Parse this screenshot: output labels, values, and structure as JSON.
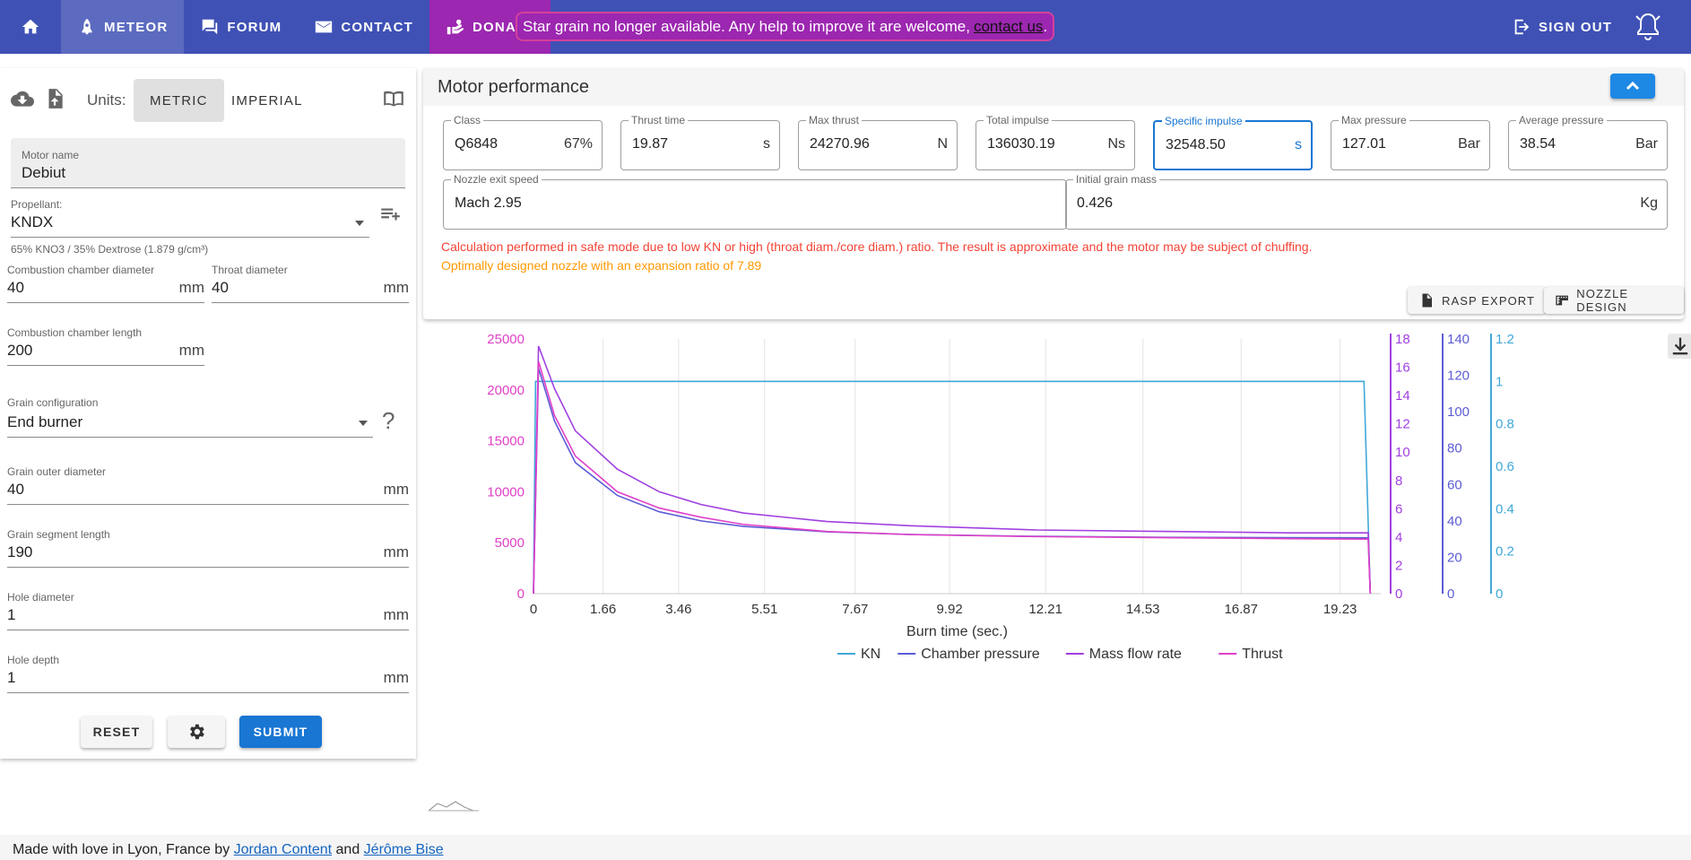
{
  "nav": {
    "home_icon": "home-icon",
    "items": [
      {
        "label": "METEOR",
        "icon": "rocket-icon"
      },
      {
        "label": "FORUM",
        "icon": "forum-icon"
      },
      {
        "label": "CONTACT",
        "icon": "mail-icon"
      },
      {
        "label": "DONATE",
        "icon": "donate-icon"
      }
    ],
    "alert_text": "Star grain no longer available. Any help to improve it are welcome,",
    "alert_link": "contact us",
    "alert_end": ".",
    "signout": "SIGN OUT",
    "colors": {
      "bar": "#3f51b5",
      "donate": "#9c27b0"
    }
  },
  "form": {
    "units_label": "Units:",
    "unit_metric": "METRIC",
    "unit_imperial": "IMPERIAL",
    "motor_name_label": "Motor name",
    "motor_name": "Debiut",
    "propellant_label": "Propellant:",
    "propellant": "KNDX",
    "propellant_hint": "65% KNO3 / 35% Dextrose (1.879 g/cm³)",
    "chamber_diameter_label": "Combustion chamber diameter",
    "chamber_diameter": "40",
    "throat_diameter_label": "Throat diameter",
    "throat_diameter": "40",
    "chamber_length_label": "Combustion chamber length",
    "chamber_length": "200",
    "grain_config_label": "Grain configuration",
    "grain_config": "End burner",
    "grain_outer_label": "Grain outer diameter",
    "grain_outer": "40",
    "segment_length_label": "Grain segment length",
    "segment_length": "190",
    "hole_diameter_label": "Hole diameter",
    "hole_diameter": "1",
    "hole_depth_label": "Hole depth",
    "hole_depth": "1",
    "unit_mm": "mm",
    "help": "?",
    "reset": "RESET",
    "submit": "SUBMIT"
  },
  "performance": {
    "title": "Motor performance",
    "class_label": "Class",
    "class": "Q6848",
    "class_pct": "67%",
    "thrust_time_label": "Thrust time",
    "thrust_time": "19.87",
    "thrust_time_unit": "s",
    "max_thrust_label": "Max thrust",
    "max_thrust": "24270.96",
    "max_thrust_unit": "N",
    "total_impulse_label": "Total impulse",
    "total_impulse": "136030.19",
    "total_impulse_unit": "Ns",
    "isp_label": "Specific impulse",
    "isp": "32548.50",
    "isp_unit": "s",
    "max_pressure_label": "Max pressure",
    "max_pressure": "127.01",
    "max_pressure_unit": "Bar",
    "avg_pressure_label": "Average pressure",
    "avg_pressure": "38.54",
    "avg_pressure_unit": "Bar",
    "nozzle_speed_label": "Nozzle exit speed",
    "nozzle_speed": "Mach 2.95",
    "grain_mass_label": "Initial grain mass",
    "grain_mass": "0.426",
    "grain_mass_unit": "Kg",
    "warning_red": "Calculation performed in safe mode due to low KN or high (throat diam./core diam.) ratio. The result is approximate and the motor may be subject of chuffing.",
    "warning_orange": "Optimally designed nozzle with an expansion ratio of 7.89",
    "rasp_export": "RASP EXPORT",
    "nozzle_design": "NOZZLE DESIGN"
  },
  "chart_data": {
    "type": "line",
    "xlabel": "Burn time (sec.)",
    "x_ticks": [
      "0",
      "1.66",
      "3.46",
      "5.51",
      "7.67",
      "9.92",
      "12.21",
      "14.53",
      "16.87",
      "19.23"
    ],
    "xlim": [
      0,
      20.2
    ],
    "axes": {
      "thrust": {
        "ticks": [
          "0",
          "5000",
          "10000",
          "15000",
          "20000",
          "25000"
        ],
        "max": 25000,
        "color": "#e040c8"
      },
      "mass_flow": {
        "ticks": [
          "0",
          "2",
          "4",
          "6",
          "8",
          "10",
          "12",
          "14",
          "16",
          "18"
        ],
        "max": 18,
        "color": "#a040e0"
      },
      "pressure": {
        "ticks": [
          "0",
          "20",
          "40",
          "60",
          "80",
          "100",
          "120",
          "140"
        ],
        "max": 140,
        "color": "#5c5cd6"
      },
      "kn": {
        "ticks": [
          "0",
          "0.2",
          "0.4",
          "0.6",
          "0.8",
          "1",
          "1.2"
        ],
        "max": 1.2,
        "color": "#40a8d8"
      }
    },
    "series": [
      {
        "name": "KN",
        "axis": "kn",
        "color": "#40a8d8",
        "x": [
          0,
          0.05,
          19.8,
          19.95
        ],
        "y": [
          0,
          1.0,
          1.0,
          0
        ]
      },
      {
        "name": "Chamber pressure",
        "axis": "pressure",
        "color": "#5c5cd6",
        "x": [
          0,
          0.12,
          0.5,
          1,
          2,
          3,
          4,
          5,
          7,
          9,
          12,
          15,
          18,
          19.9,
          19.95
        ],
        "y": [
          0,
          124,
          95,
          72,
          54,
          45,
          40,
          37,
          34,
          32.5,
          31.5,
          31,
          30.8,
          30.7,
          0
        ]
      },
      {
        "name": "Mass flow rate",
        "axis": "mass_flow",
        "color": "#a040e0",
        "x": [
          0,
          0.12,
          0.5,
          1,
          2,
          3,
          4,
          5,
          7,
          9,
          12,
          15,
          18,
          19.9,
          19.95
        ],
        "y": [
          0,
          17.5,
          14.5,
          11.5,
          8.8,
          7.2,
          6.3,
          5.7,
          5.1,
          4.8,
          4.5,
          4.4,
          4.3,
          4.3,
          0
        ]
      },
      {
        "name": "Thrust",
        "axis": "thrust",
        "color": "#e040c8",
        "x": [
          0,
          0.12,
          0.5,
          1,
          2,
          3,
          4,
          5,
          7,
          9,
          12,
          15,
          18,
          19.9,
          19.95
        ],
        "y": [
          0,
          22800,
          17500,
          13500,
          10000,
          8400,
          7500,
          6800,
          6100,
          5800,
          5600,
          5500,
          5400,
          5350,
          0
        ]
      }
    ],
    "legend_position": "bottom-center",
    "grid": "vertical"
  },
  "footer": {
    "text": "Made with love in Lyon, France by",
    "author1": "Jordan Content",
    "and": "and",
    "author2": "Jérôme Bise"
  }
}
